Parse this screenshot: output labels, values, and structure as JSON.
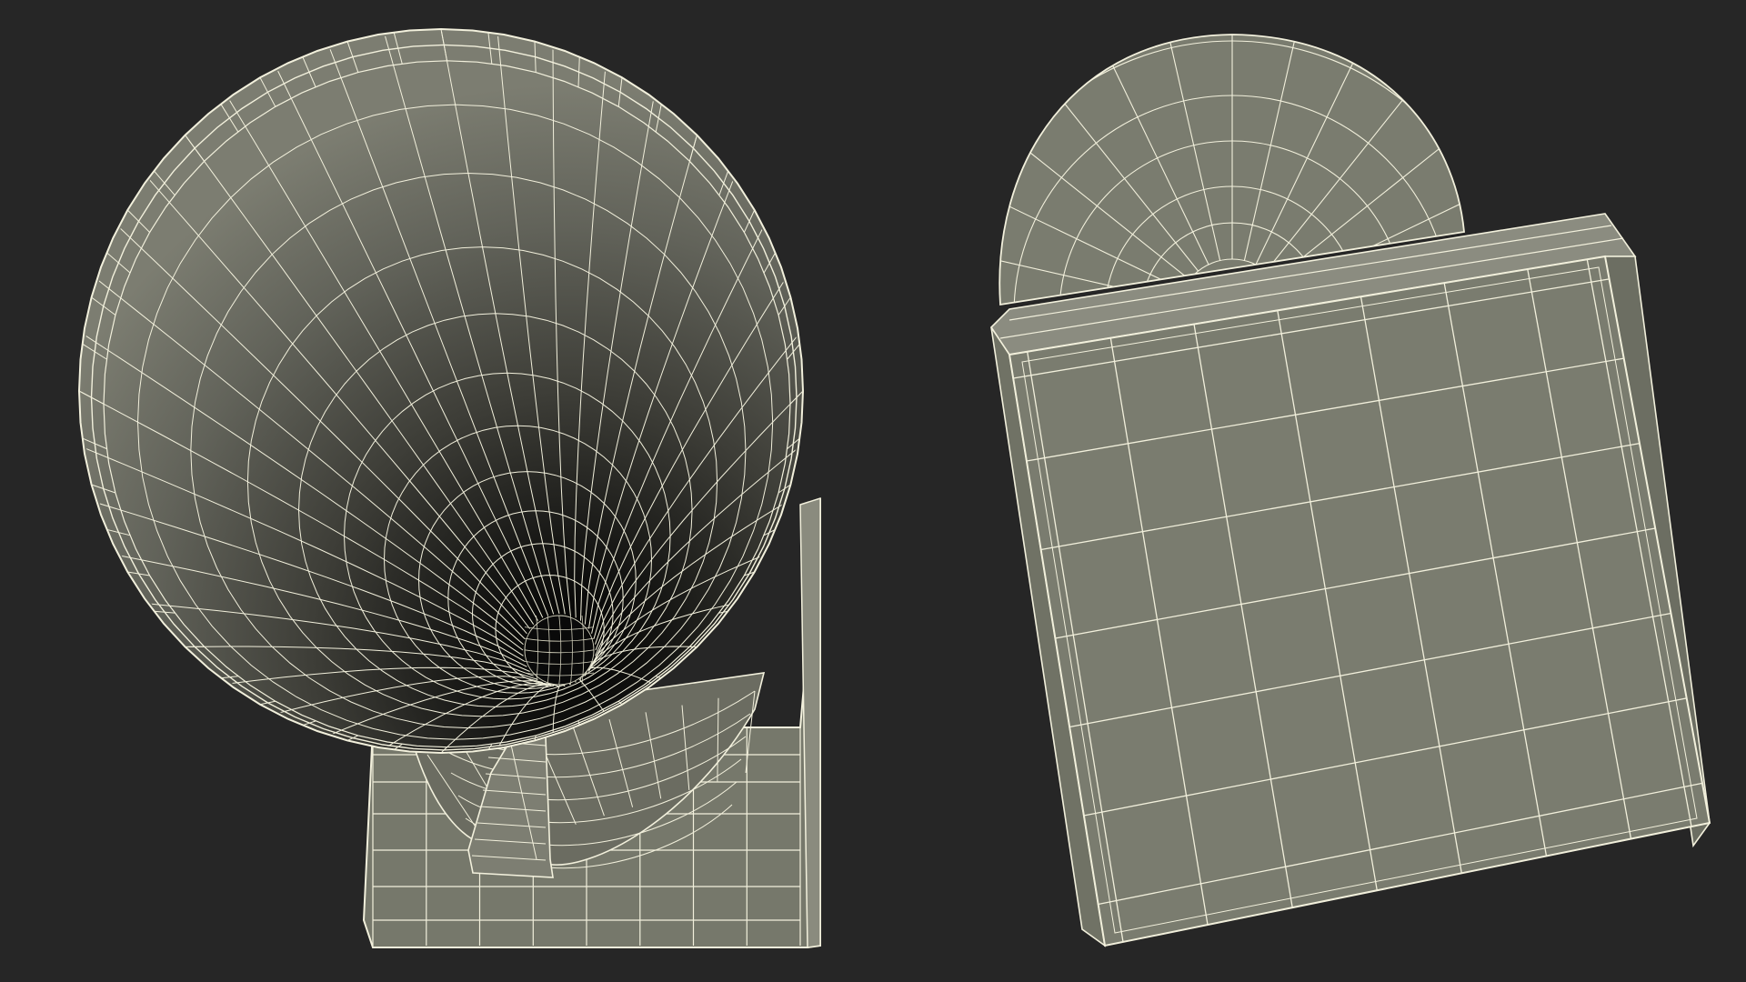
{
  "scene": {
    "background_color": "#262626",
    "objects": [
      {
        "name": "gramophone-horn-front-view",
        "fill": "#787a6c",
        "wire": "#f2f0dc"
      },
      {
        "name": "gramophone-box-top-view",
        "fill": "#7a7c6f",
        "wire": "#f2f0dc"
      }
    ]
  }
}
